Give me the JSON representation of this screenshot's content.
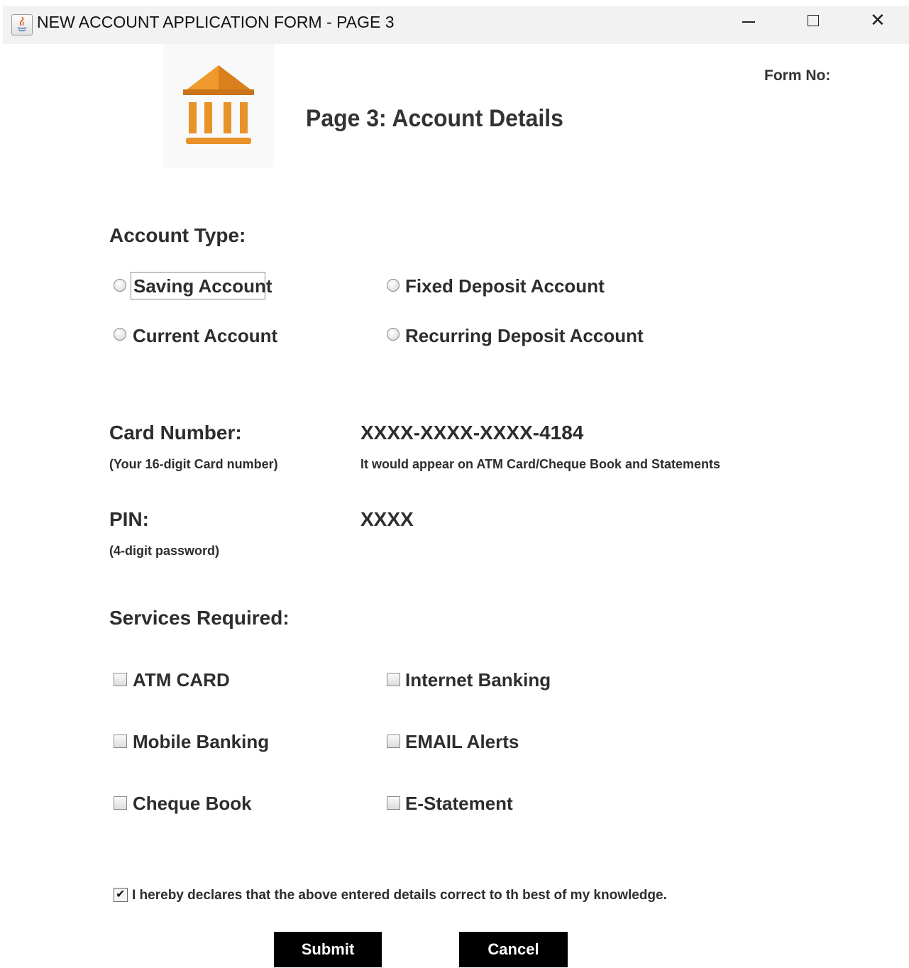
{
  "window": {
    "title": "NEW ACCOUNT APPLICATION FORM - PAGE 3",
    "close_glyph": "✕"
  },
  "header": {
    "form_no_label": "Form No:",
    "page_title": "Page 3: Account Details",
    "logo_icon": "bank-building-icon",
    "logo_color": "#e8922a"
  },
  "account_type": {
    "heading": "Account Type:",
    "options": [
      "Saving Account",
      "Fixed Deposit Account",
      "Current Account",
      "Recurring Deposit Account"
    ]
  },
  "card": {
    "label": "Card Number:",
    "hint": "(Your 16-digit Card number)",
    "value": "XXXX-XXXX-XXXX-4184",
    "note": "It would appear on ATM Card/Cheque Book and Statements"
  },
  "pin": {
    "label": "PIN:",
    "hint": "(4-digit password)",
    "value": "XXXX"
  },
  "services": {
    "heading": "Services Required:",
    "options": [
      "ATM CARD",
      "Internet Banking",
      "Mobile Banking",
      "EMAIL Alerts",
      "Cheque Book",
      "E-Statement"
    ]
  },
  "declaration": {
    "text": "I hereby declares that the above entered details correct to th best of my knowledge.",
    "checked": true,
    "check_glyph": "✔"
  },
  "buttons": {
    "submit": "Submit",
    "cancel": "Cancel"
  }
}
